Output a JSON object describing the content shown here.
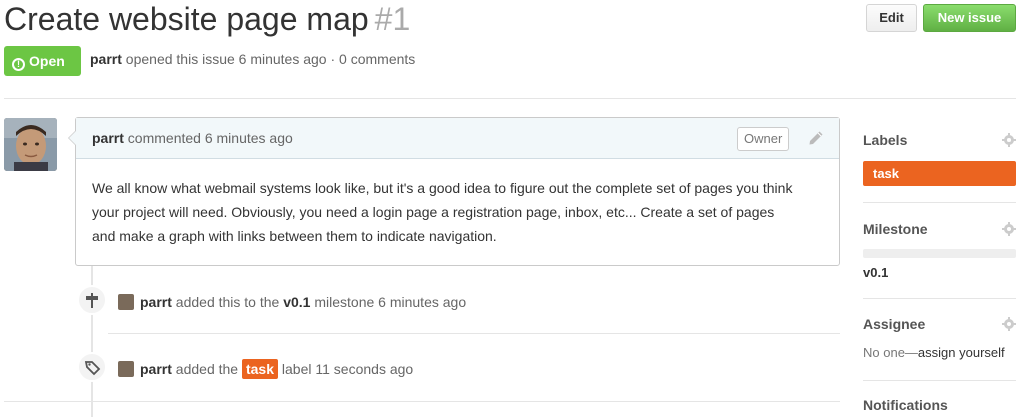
{
  "issue": {
    "title": "Create website page map",
    "number": "#1",
    "state": "Open",
    "author": "parrt",
    "meta_text": "opened this issue 6 minutes ago · 0 comments"
  },
  "header": {
    "edit_label": "Edit",
    "new_issue_label": "New issue"
  },
  "comment": {
    "author": "parrt",
    "time_text": "commented 6 minutes ago",
    "role_badge": "Owner",
    "body": "We all know what webmail systems look like, but it's a good idea to figure out the complete set of pages you think your project will need. Obviously, you need a login page a registration page, inbox, etc... Create a set of pages and make a graph with links between them to indicate navigation."
  },
  "timeline": [
    {
      "icon": "milestone-icon",
      "actor": "parrt",
      "text_before": "added this to the",
      "target": "v0.1",
      "text_after": "milestone 6 minutes ago"
    },
    {
      "icon": "tag-icon",
      "actor": "parrt",
      "text_before": "added the",
      "target": "task",
      "text_after": "label 11 seconds ago"
    }
  ],
  "sidebar": {
    "labels_title": "Labels",
    "label_task": "task",
    "label_color": "#eb6420",
    "milestone_title": "Milestone",
    "milestone_value": "v0.1",
    "assignee_title": "Assignee",
    "assignee_none": "No one—",
    "assign_yourself": "assign yourself",
    "notifications_title": "Notifications"
  },
  "colors": {
    "open": "#6cc644",
    "new_issue": "#60b044",
    "label_task": "#eb6420"
  }
}
